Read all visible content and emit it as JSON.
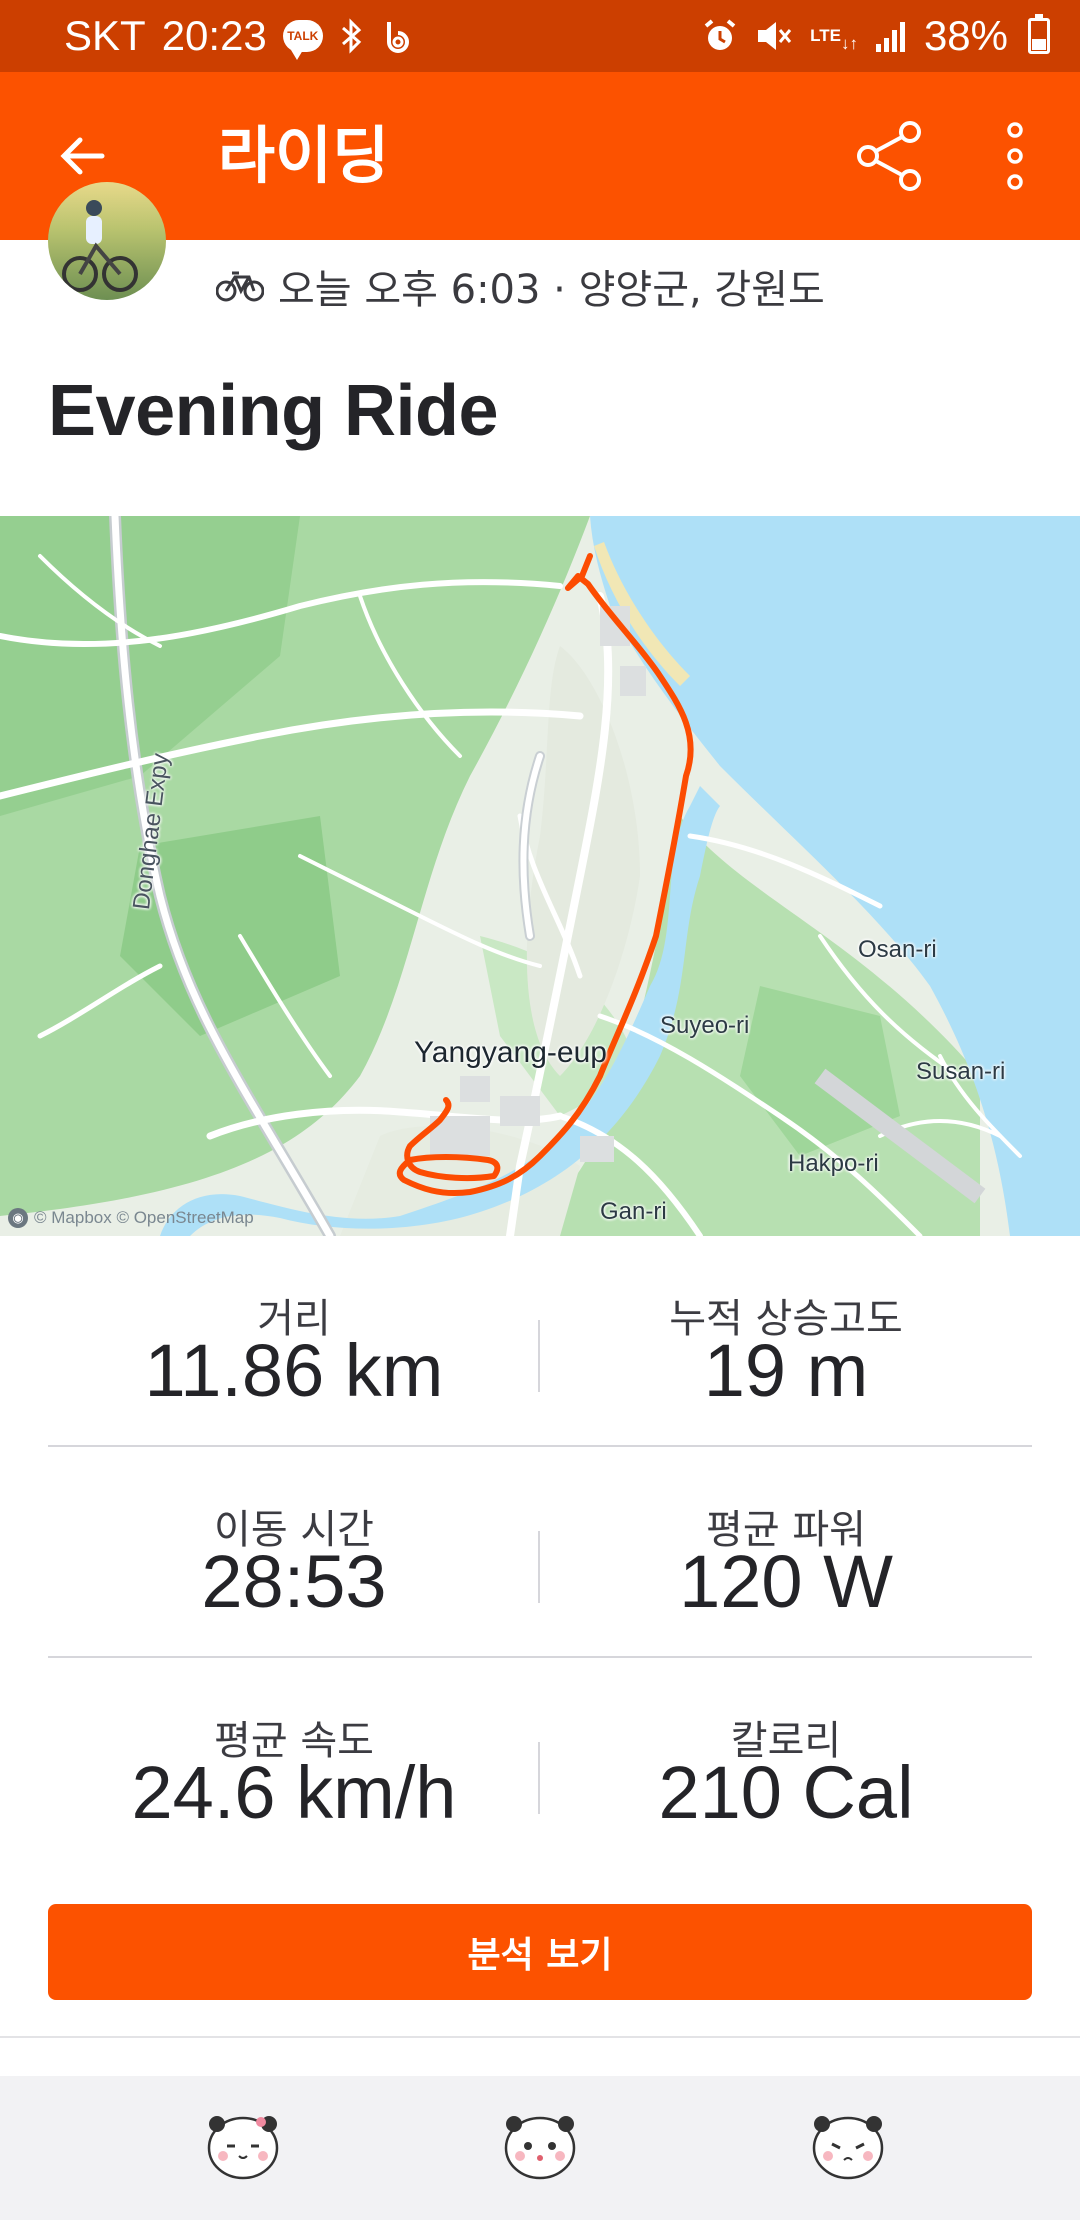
{
  "status_bar": {
    "carrier": "SKT",
    "time": "20:23",
    "talk_badge": "TALK",
    "network": "LTE",
    "battery": "38%"
  },
  "app_bar": {
    "title": "라이딩"
  },
  "activity": {
    "meta": "오늘 오후 6:03 · 양양군, 강원도",
    "title": "Evening Ride"
  },
  "map": {
    "labels": {
      "expressway": "Donghae Expy",
      "town": "Yangyang-eup",
      "osan": "Osan-ri",
      "suyeo": "Suyeo-ri",
      "susan": "Susan-ri",
      "hakpo": "Hakpo-ri",
      "gan": "Gan-ri"
    },
    "attribution": "© Mapbox © OpenStreetMap",
    "route_color": "#fc4c02"
  },
  "stats": [
    {
      "left": {
        "label": "거리",
        "value": "11.86 km"
      },
      "right": {
        "label": "누적 상승고도",
        "value": "19 m"
      }
    },
    {
      "left": {
        "label": "이동 시간",
        "value": "28:53"
      },
      "right": {
        "label": "평균 파워",
        "value": "120 W"
      }
    },
    {
      "left": {
        "label": "평균 속도",
        "value": "24.6 km/h"
      },
      "right": {
        "label": "칼로리",
        "value": "210 Cal"
      }
    }
  ],
  "analyze_button": "분석 보기",
  "colors": {
    "brand": "#fc5200",
    "status_bar": "#cc3f00",
    "water": "#aee0f7",
    "forest": "#a9d9a3"
  },
  "icons": {
    "back": "back-arrow-icon",
    "share": "share-icon",
    "more": "more-vertical-icon",
    "activity_type": "bicycle-icon"
  }
}
